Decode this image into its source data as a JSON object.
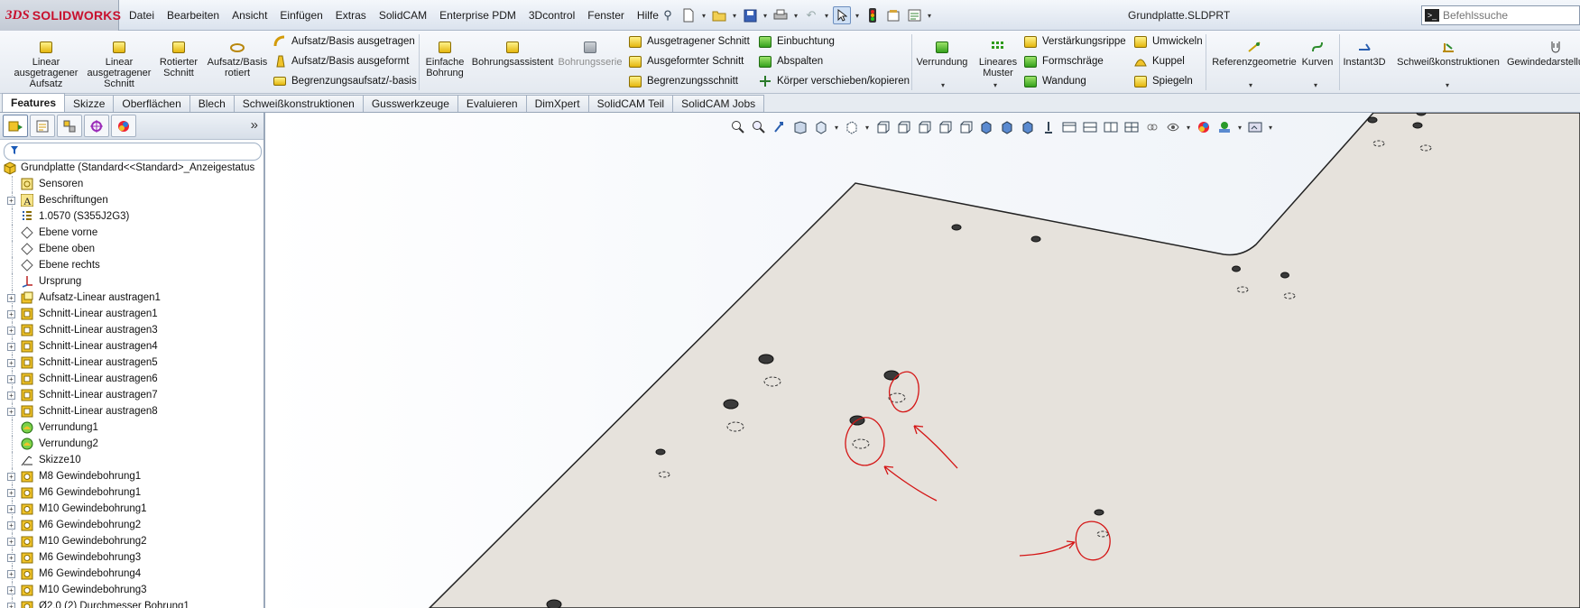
{
  "app": {
    "brand_prefix": "3DS",
    "brand_name": "SOLIDWORKS",
    "document_title": "Grundplatte.SLDPRT"
  },
  "menu": [
    "Datei",
    "Bearbeiten",
    "Ansicht",
    "Einfügen",
    "Extras",
    "SolidCAM",
    "Enterprise PDM",
    "3Dcontrol",
    "Fenster",
    "Hilfe"
  ],
  "search": {
    "placeholder": "Befehlssuche",
    "icon": "command-search-icon"
  },
  "commands": {
    "linear_boss": "Linear ausgetragener Aufsatz",
    "linear_cut": "Linear ausgetragener Schnitt",
    "revolved_cut": "Rotierter Schnitt",
    "revolved_boss": "Aufsatz/Basis rotiert",
    "swept_boss": "Aufsatz/Basis ausgetragen",
    "lofted_boss": "Aufsatz/Basis ausgeformt",
    "boundary_boss": "Begrenzungsaufsatz/-basis",
    "simple_hole": "Einfache Bohrung",
    "hole_wizard": "Bohrungsassistent",
    "hole_series": "Bohrungsserie",
    "swept_cut": "Ausgetragener Schnitt",
    "lofted_cut": "Ausgeformter Schnitt",
    "boundary_cut": "Begrenzungsschnitt",
    "indent": "Einbuchtung",
    "split": "Abspalten",
    "move_copy": "Körper verschieben/kopieren",
    "fillet": "Verrundung",
    "linear_pattern": "Lineares Muster",
    "rib": "Verstärkungsrippe",
    "draft": "Formschräge",
    "shell": "Wandung",
    "wrap": "Umwickeln",
    "dome": "Kuppel",
    "mirror": "Spiegeln",
    "ref_geometry": "Referenzgeometrie",
    "curves": "Kurven",
    "instant3d": "Instant3D",
    "weldments": "Schweißkonstruktionen",
    "thread": "Gewindedarstellung"
  },
  "tabs": [
    "Features",
    "Skizze",
    "Oberflächen",
    "Blech",
    "Schweißkonstruktionen",
    "Gusswerkzeuge",
    "Evaluieren",
    "DimXpert",
    "SolidCAM Teil",
    "SolidCAM Jobs"
  ],
  "active_tab": "Features",
  "tree": {
    "root": "Grundplatte  (Standard<<Standard>_Anzeigestatus",
    "items": [
      {
        "label": "Sensoren",
        "icon": "sensor-icon",
        "expandable": false
      },
      {
        "label": "Beschriftungen",
        "icon": "annotations-icon",
        "expandable": true
      },
      {
        "label": "1.0570 (S355J2G3)",
        "icon": "material-icon",
        "expandable": false
      },
      {
        "label": "Ebene vorne",
        "icon": "plane-icon",
        "expandable": false
      },
      {
        "label": "Ebene oben",
        "icon": "plane-icon",
        "expandable": false
      },
      {
        "label": "Ebene rechts",
        "icon": "plane-icon",
        "expandable": false
      },
      {
        "label": "Ursprung",
        "icon": "origin-icon",
        "expandable": false
      },
      {
        "label": "Aufsatz-Linear austragen1",
        "icon": "extrude-boss-icon",
        "expandable": true
      },
      {
        "label": "Schnitt-Linear austragen1",
        "icon": "extrude-cut-icon",
        "expandable": true
      },
      {
        "label": "Schnitt-Linear austragen3",
        "icon": "extrude-cut-icon",
        "expandable": true
      },
      {
        "label": "Schnitt-Linear austragen4",
        "icon": "extrude-cut-icon",
        "expandable": true
      },
      {
        "label": "Schnitt-Linear austragen5",
        "icon": "extrude-cut-icon",
        "expandable": true
      },
      {
        "label": "Schnitt-Linear austragen6",
        "icon": "extrude-cut-icon",
        "expandable": true
      },
      {
        "label": "Schnitt-Linear austragen7",
        "icon": "extrude-cut-icon",
        "expandable": true
      },
      {
        "label": "Schnitt-Linear austragen8",
        "icon": "extrude-cut-icon",
        "expandable": true
      },
      {
        "label": "Verrundung1",
        "icon": "fillet-icon",
        "expandable": false
      },
      {
        "label": "Verrundung2",
        "icon": "fillet-icon",
        "expandable": false
      },
      {
        "label": "Skizze10",
        "icon": "sketch-icon",
        "expandable": false
      },
      {
        "label": "M8 Gewindebohrung1",
        "icon": "hole-wizard-icon",
        "expandable": true
      },
      {
        "label": "M6 Gewindebohrung1",
        "icon": "hole-wizard-icon",
        "expandable": true
      },
      {
        "label": "M10 Gewindebohrung1",
        "icon": "hole-wizard-icon",
        "expandable": true
      },
      {
        "label": "M6 Gewindebohrung2",
        "icon": "hole-wizard-icon",
        "expandable": true
      },
      {
        "label": "M10 Gewindebohrung2",
        "icon": "hole-wizard-icon",
        "expandable": true
      },
      {
        "label": "M6 Gewindebohrung3",
        "icon": "hole-wizard-icon",
        "expandable": true
      },
      {
        "label": "M6 Gewindebohrung4",
        "icon": "hole-wizard-icon",
        "expandable": true
      },
      {
        "label": "M10 Gewindebohrung3",
        "icon": "hole-wizard-icon",
        "expandable": true
      },
      {
        "label": "Ø2,0 (2) Durchmesser Bohrung1",
        "icon": "hole-wizard-icon",
        "expandable": true
      }
    ]
  },
  "colors": {
    "brand_red": "#c8102e",
    "part_face": "#e6e2dc",
    "markup_red": "#d41515",
    "feature_yellow": "#e4b60d",
    "feature_green": "#35a11c"
  }
}
